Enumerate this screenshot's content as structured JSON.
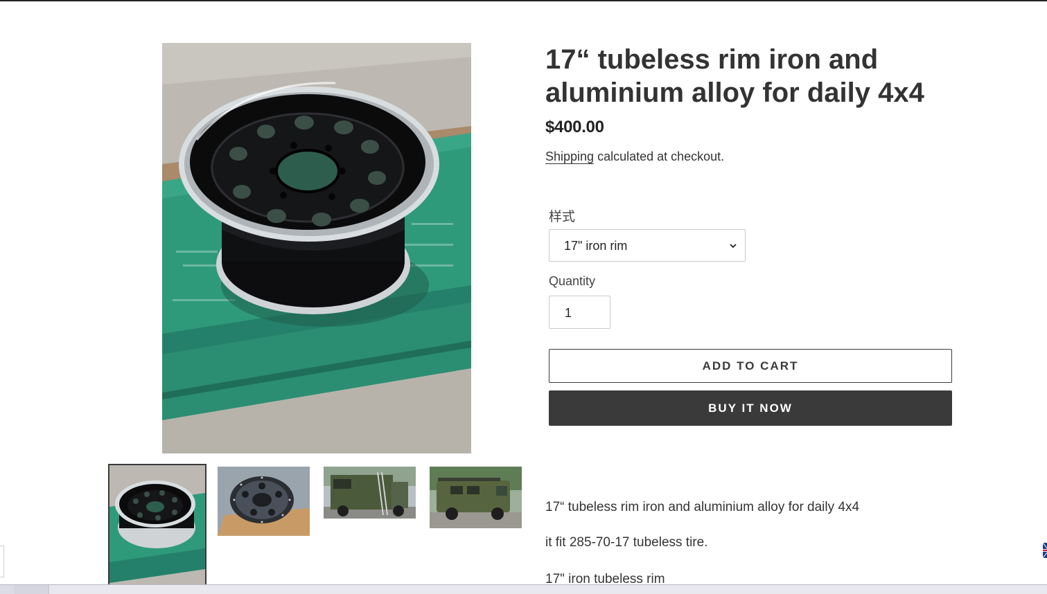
{
  "product": {
    "title": "17“ tubeless rim iron and aluminium alloy for daily 4x4",
    "price": "$400.00",
    "shipping_link": "Shipping",
    "shipping_rest": " calculated at checkout."
  },
  "options": {
    "style_label": "样式",
    "style_selected": "17\" iron rim",
    "quantity_label": "Quantity",
    "quantity_value": "1"
  },
  "buttons": {
    "add_to_cart": "ADD TO CART",
    "buy_now": "BUY IT NOW"
  },
  "gallery": {
    "main_image": "black-steel-wheel-rim-photo",
    "thumbnails": [
      "black-rim-on-green-pallet",
      "beadlock-rim-on-box",
      "green-camper-van-with-ladder",
      "green-off-road-van-side"
    ],
    "selected_thumbnail": 1
  },
  "description": {
    "line_1": "17“ tubeless rim iron and aluminium alloy for daily 4x4",
    "line_2": "it fit 285-70-17 tubeless tire.",
    "line_3": "17\" iron tubeless rim"
  },
  "colors": {
    "text": "#3a3a3a",
    "buy_button": "#3a3a3a",
    "border": "#c9c9c9"
  }
}
